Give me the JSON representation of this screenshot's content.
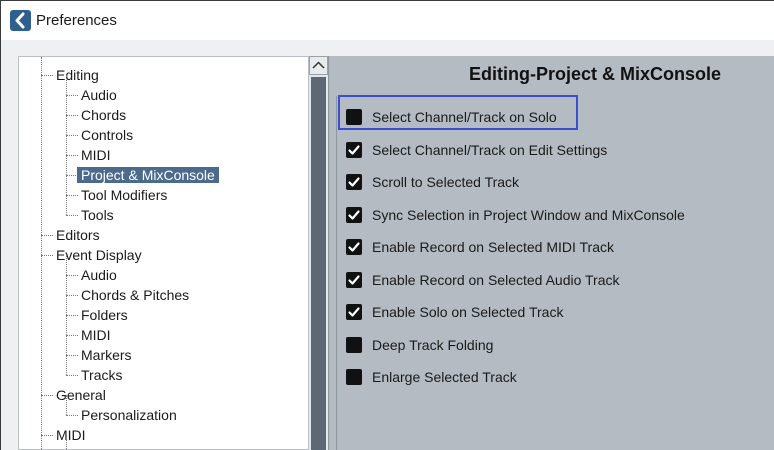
{
  "window": {
    "title": "Preferences",
    "icon": "cubase-chevron-icon"
  },
  "tree": {
    "items": [
      {
        "label": "Editing",
        "level": 0
      },
      {
        "label": "Audio",
        "level": 1
      },
      {
        "label": "Chords",
        "level": 1
      },
      {
        "label": "Controls",
        "level": 1
      },
      {
        "label": "MIDI",
        "level": 1
      },
      {
        "label": "Project & MixConsole",
        "level": 1,
        "selected": true
      },
      {
        "label": "Tool Modifiers",
        "level": 1
      },
      {
        "label": "Tools",
        "level": 1
      },
      {
        "label": "Editors",
        "level": 0
      },
      {
        "label": "Event Display",
        "level": 0
      },
      {
        "label": "Audio",
        "level": 1
      },
      {
        "label": "Chords & Pitches",
        "level": 1
      },
      {
        "label": "Folders",
        "level": 1
      },
      {
        "label": "MIDI",
        "level": 1
      },
      {
        "label": "Markers",
        "level": 1
      },
      {
        "label": "Tracks",
        "level": 1
      },
      {
        "label": "General",
        "level": 0
      },
      {
        "label": "Personalization",
        "level": 1
      },
      {
        "label": "MIDI",
        "level": 0
      }
    ]
  },
  "settings": {
    "title": "Editing-Project & MixConsole",
    "options": [
      {
        "label": "Select Channel/Track on Solo",
        "checked": false,
        "focused": true
      },
      {
        "label": "Select Channel/Track on Edit Settings",
        "checked": true
      },
      {
        "label": "Scroll to Selected Track",
        "checked": true
      },
      {
        "label": "Sync Selection in Project Window and MixConsole",
        "checked": true
      },
      {
        "label": "Enable Record on Selected MIDI Track",
        "checked": true
      },
      {
        "label": "Enable Record on Selected Audio Track",
        "checked": true
      },
      {
        "label": "Enable Solo on Selected Track",
        "checked": true
      },
      {
        "label": "Deep Track Folding",
        "checked": false
      },
      {
        "label": "Enlarge Selected Track",
        "checked": false
      }
    ]
  },
  "colors": {
    "accent_focus": "#3a4fd0",
    "selection": "#4c6a8b",
    "panel_bg": "#b4bbc2"
  }
}
